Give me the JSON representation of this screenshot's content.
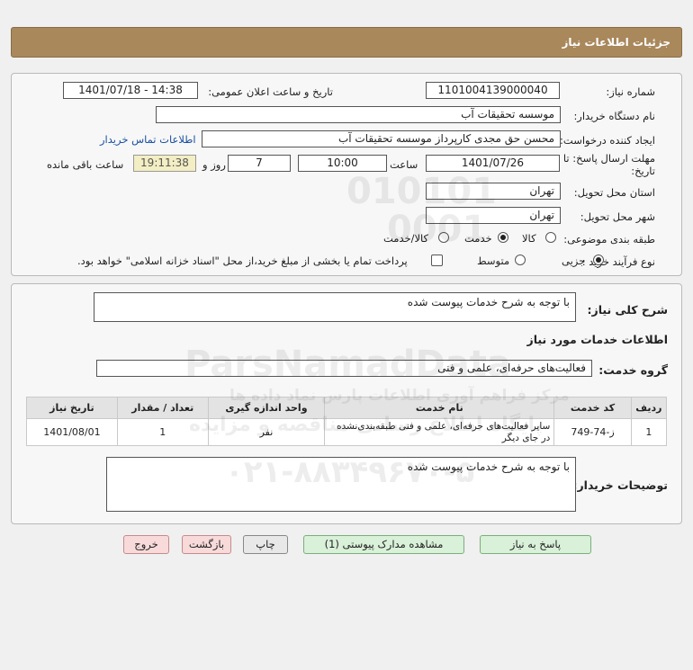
{
  "header": {
    "title": "جزئیات اطلاعات نیاز"
  },
  "details": {
    "need_number_label": "شماره نیاز:",
    "need_number": "1101004139000040",
    "announce_label": "تاریخ و ساعت اعلان عمومی:",
    "announce_value": "1401/07/18 - 14:38",
    "buyer_org_label": "نام دستگاه خریدار:",
    "buyer_org": "موسسه تحقیقات آب",
    "creator_label": "ایجاد کننده درخواست:",
    "creator": "محسن حق مجدی کارپرداز موسسه تحقیقات آب",
    "contact_link": "اطلاعات تماس خریدار",
    "deadline_label_1": "مهلت ارسال پاسخ: تا",
    "deadline_label_2": "تاریخ:",
    "deadline_date": "1401/07/26",
    "time_label": "ساعت",
    "deadline_time": "10:00",
    "days_value": "7",
    "days_label": "روز و",
    "remaining_time": "19:11:38",
    "remaining_label": "ساعت باقی مانده",
    "province_label": "استان محل تحویل:",
    "province": "تهران",
    "city_label": "شهر محل تحویل:",
    "city": "تهران",
    "category_label": "طبقه بندی موضوعی:",
    "category_options": [
      "کالا",
      "خدمت",
      "کالا/خدمت"
    ],
    "category_selected": "خدمت",
    "process_label": "نوع فرآیند خرید :",
    "process_options": [
      "جزیی",
      "متوسط"
    ],
    "process_selected": "جزیی",
    "payment_note": "پرداخت تمام یا بخشی از مبلغ خرید،از محل \"اسناد خزانه اسلامی\" خواهد بود."
  },
  "summary": {
    "label": "شرح کلی نیاز:",
    "text": "با توجه به شرح خدمات پیوست شده",
    "services_heading": "اطلاعات خدمات مورد نیاز",
    "group_label": "گروه خدمت:",
    "group_value": "فعالیت‌های حرفه‌ای، علمی و فنی"
  },
  "table": {
    "headers": [
      "ردیف",
      "کد خدمت",
      "نام خدمت",
      "واحد اندازه گیری",
      "تعداد / مقدار",
      "تاریخ نیاز"
    ],
    "rows": [
      [
        "1",
        "ز-74-749",
        "سایر فعالیت‌های حرفه‌ای، علمی و فنی طبقه‌بندی‌نشده در جای دیگر",
        "نفر",
        "1",
        "1401/08/01"
      ]
    ]
  },
  "buyer_notes": {
    "label": "توضیحات خریدار:",
    "text": "با توجه به شرح خدمات پیوست شده"
  },
  "buttons": {
    "reply": "پاسخ به نیاز",
    "view_docs": "مشاهده مدارک پیوستی (1)",
    "print": "چاپ",
    "back": "بازگشت",
    "exit": "خروج"
  },
  "watermark": {
    "num1": "010101",
    "num2": "0001",
    "brand": "ParsNamadData",
    "sub1": "مرکز فراهم آوری اطلاعات پارس نماد داده ها",
    "sub2": "پایگاه اطلاع رسانی مناقصه و مزایده",
    "phone": "۰۲۱-۸۸۳۴۹۶۷۰-۵"
  }
}
